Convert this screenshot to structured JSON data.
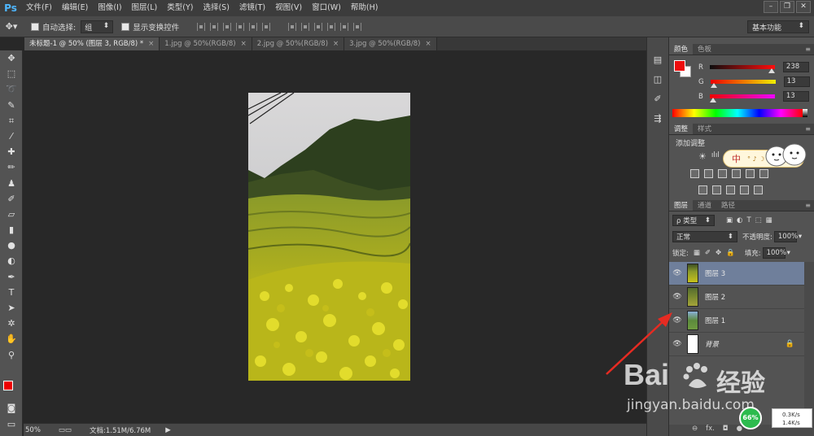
{
  "app": {
    "logo": "Ps"
  },
  "menu": [
    "文件(F)",
    "编辑(E)",
    "图像(I)",
    "图层(L)",
    "类型(Y)",
    "选择(S)",
    "滤镜(T)",
    "视图(V)",
    "窗口(W)",
    "帮助(H)"
  ],
  "window_controls": {
    "minimize": "–",
    "maximize": "❐",
    "close": "✕"
  },
  "options": {
    "auto_select_label": "自动选择:",
    "auto_select_value": "组",
    "show_transform_label": "显示变换控件",
    "workspace": "基本功能"
  },
  "tabs": [
    {
      "label": "未标题-1 @ 50% (图层 3, RGB/8) *",
      "active": true
    },
    {
      "label": "1.jpg @ 50%(RGB/8)",
      "active": false
    },
    {
      "label": "2.jpg @ 50%(RGB/8)",
      "active": false
    },
    {
      "label": "3.jpg @ 50%(RGB/8)",
      "active": false
    }
  ],
  "tab_close": "×",
  "status": {
    "zoom": "50%",
    "doc": "文档:1.51M/6.76M",
    "arrow": "▶"
  },
  "color_panel": {
    "tabs": [
      "颜色",
      "色板"
    ],
    "r_label": "R",
    "r_value": "238",
    "g_label": "G",
    "g_value": "13",
    "b_label": "B",
    "b_value": "13",
    "foreground_color": "#ee0d0d"
  },
  "adjust_panel": {
    "tabs": [
      "调整",
      "样式"
    ],
    "title": "添加调整",
    "ime_char": "中",
    "ime_symbols": "° ♪ ☽"
  },
  "layers_panel": {
    "tabs": [
      "图层",
      "通道",
      "路径"
    ],
    "filter_label": "ρ 类型",
    "blend_mode": "正常",
    "opacity_label": "不透明度:",
    "opacity_value": "100%",
    "lock_label": "锁定:",
    "fill_label": "填充:",
    "fill_value": "100%",
    "layers": [
      {
        "name": "图层 3",
        "selected": true
      },
      {
        "name": "图层 2",
        "selected": false
      },
      {
        "name": "图层 1",
        "selected": false
      },
      {
        "name": "背景",
        "selected": false,
        "locked": true
      }
    ],
    "footer": [
      "⊖",
      "fx.",
      "◘",
      "●"
    ]
  },
  "watermark": {
    "brand": "Bai",
    "brand_cn": "经验",
    "url": "jingyan.baidu.com"
  },
  "net_speed": {
    "percent": "66%",
    "up": "0.3K/s",
    "down": "1.4K/s"
  }
}
